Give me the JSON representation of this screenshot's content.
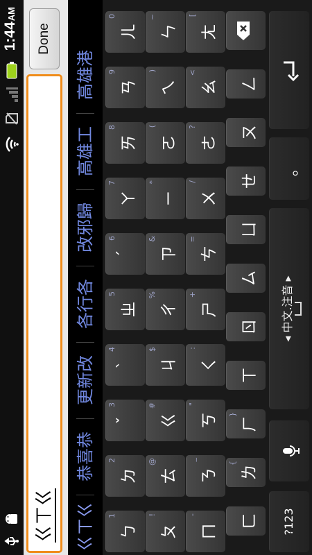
{
  "status_bar": {
    "time": "1:44",
    "time_suffix": "AM",
    "icons": [
      "usb-icon",
      "android-debug-icon",
      "wifi-icon",
      "no-sim-icon",
      "signal-icon",
      "battery-icon"
    ]
  },
  "field": {
    "value": "ㄍㄒㄍ"
  },
  "done_button": {
    "label": "Done"
  },
  "candidates": [
    "ㄍㄒㄍ",
    "恭喜恭",
    "更新改",
    "各行各",
    "改邪歸",
    "高雄工",
    "高雄港"
  ],
  "keyboard": {
    "row1": [
      {
        "main": "ㄅ",
        "hint": "1"
      },
      {
        "main": "ㄉ",
        "hint": "2"
      },
      {
        "main": "ˇ",
        "hint": "3"
      },
      {
        "main": "ˋ",
        "hint": "4"
      },
      {
        "main": "ㄓ",
        "hint": "5"
      },
      {
        "main": "ˊ",
        "hint": "6"
      },
      {
        "main": "ㄚ",
        "hint": "7"
      },
      {
        "main": "ㄞ",
        "hint": "8"
      },
      {
        "main": "ㄢ",
        "hint": "9"
      },
      {
        "main": "ㄦ",
        "hint": "0"
      }
    ],
    "row2": [
      {
        "main": "ㄆ",
        "hint": "!"
      },
      {
        "main": "ㄊ",
        "hint": "@"
      },
      {
        "main": "ㄍ",
        "hint": "#"
      },
      {
        "main": "ㄐ",
        "hint": "$"
      },
      {
        "main": "ㄔ",
        "hint": "%"
      },
      {
        "main": "ㄗ",
        "hint": "&"
      },
      {
        "main": "ㄧ",
        "hint": "*"
      },
      {
        "main": "ㄛ",
        "hint": "("
      },
      {
        "main": "ㄟ",
        "hint": ")"
      },
      {
        "main": "ㄣ",
        "hint": "~"
      }
    ],
    "row3": [
      {
        "main": "ㄇ",
        "hint": "-"
      },
      {
        "main": "ㄋ",
        "hint": "_"
      },
      {
        "main": "ㄎ",
        "hint": "\""
      },
      {
        "main": "ㄑ",
        "hint": ":"
      },
      {
        "main": "ㄕ",
        "hint": "+"
      },
      {
        "main": "ㄘ",
        "hint": "="
      },
      {
        "main": "ㄨ",
        "hint": "/"
      },
      {
        "main": "ㄜ",
        "hint": "?"
      },
      {
        "main": "ㄠ",
        "hint": "<"
      },
      {
        "main": "ㄤ",
        "hint": "["
      }
    ],
    "row4": [
      {
        "main": "ㄈ",
        "hint": ""
      },
      {
        "main": "ㄌ",
        "hint": "{"
      },
      {
        "main": "ㄏ",
        "hint": "}"
      },
      {
        "main": "ㄒ",
        "hint": ""
      },
      {
        "main": "ㄖ",
        "hint": ""
      },
      {
        "main": "ㄙ",
        "hint": ""
      },
      {
        "main": "ㄩ",
        "hint": ""
      },
      {
        "main": "ㄝ",
        "hint": ""
      },
      {
        "main": "ㄡ",
        "hint": ""
      },
      {
        "main": "ㄥ",
        "hint": ""
      },
      {
        "main": "✕",
        "hint": ""
      }
    ],
    "symbols_key": "?123",
    "mic_key": "🎤",
    "space_label": "◂ 中文.注音 ▸",
    "period_key": "。",
    "enter_key": "↵"
  }
}
